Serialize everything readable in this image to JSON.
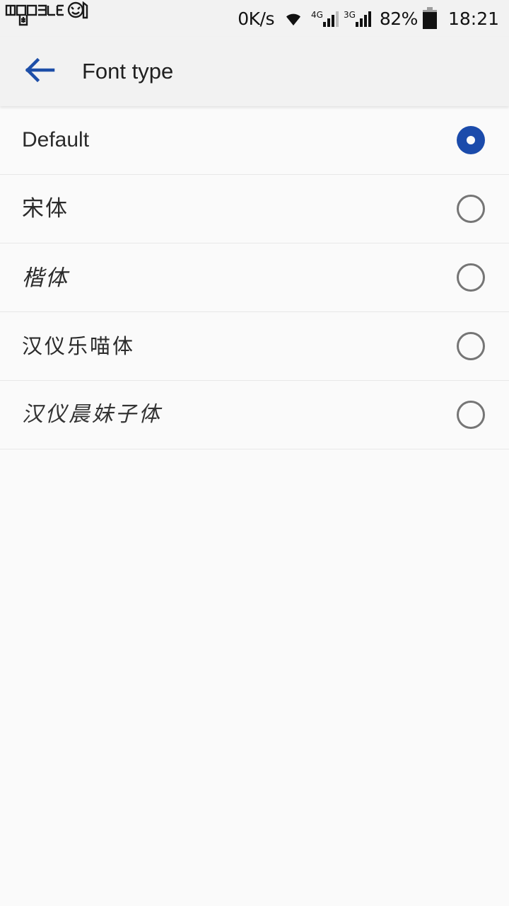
{
  "status_bar": {
    "watermark": "mobile",
    "network_speed": "0K/s",
    "wifi_icon": "wifi-icon",
    "sim1_label": "4G",
    "sim2_label": "3G",
    "battery_percent": "82%",
    "battery_icon": "battery-icon",
    "time": "18:21"
  },
  "app_bar": {
    "back_icon": "back-arrow-icon",
    "title": "Font type",
    "accent_color": "#1b4bab"
  },
  "font_list": {
    "items": [
      {
        "label": "Default",
        "style": "latin",
        "selected": true
      },
      {
        "label": "宋体",
        "style": "serif",
        "selected": false
      },
      {
        "label": "楷体",
        "style": "kai",
        "selected": false
      },
      {
        "label": "汉仪乐喵体",
        "style": "round",
        "selected": false
      },
      {
        "label": "汉仪晨妹子体",
        "style": "hand",
        "selected": false
      }
    ]
  },
  "colors": {
    "status_bar_bg": "#f2f2f2",
    "app_bar_bg": "#f2f2f2",
    "page_bg": "#fafafa",
    "divider": "#e8e8e8",
    "radio_selected": "#1b4bab",
    "radio_unselected": "#757575",
    "text_primary": "#2b2b2b"
  }
}
